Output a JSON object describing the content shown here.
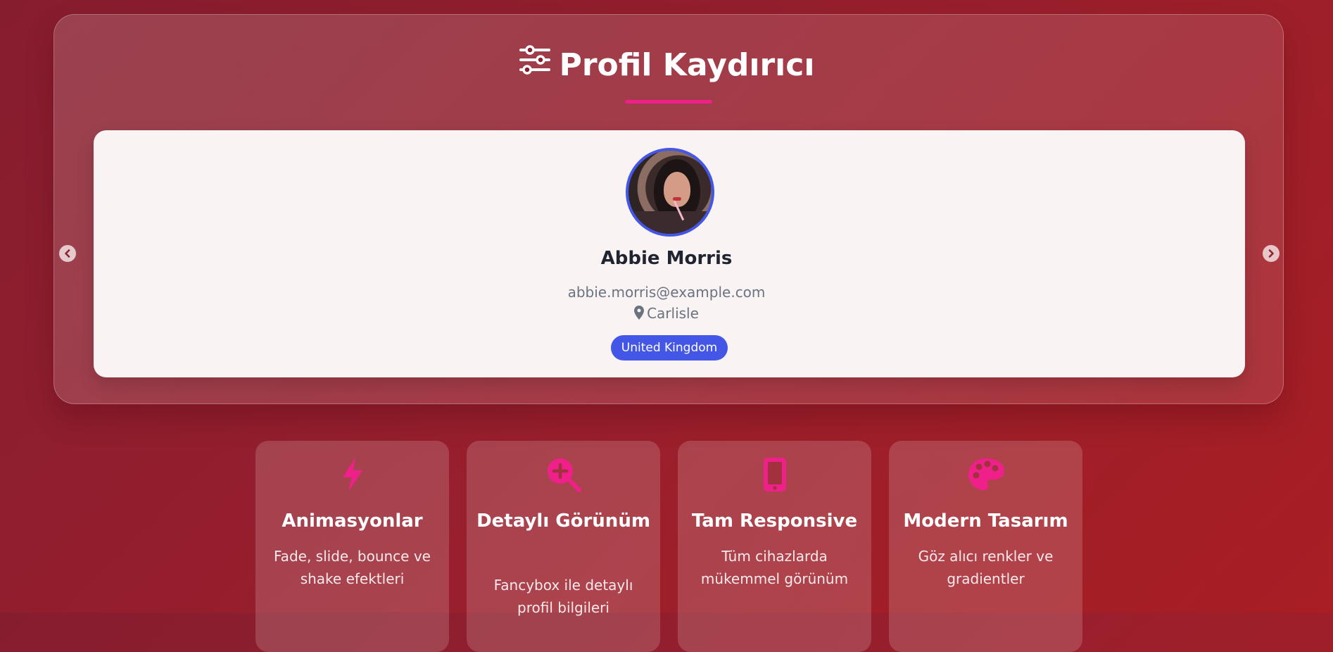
{
  "header": {
    "title": "Profil Kaydırıcı",
    "title_icon": "sliders-icon"
  },
  "profile": {
    "name": "Abbie Morris",
    "email": "abbie.morris@example.com",
    "city": "Carlisle",
    "country": "United Kingdom",
    "avatar_icon": "profile-photo"
  },
  "navigation": {
    "prev_icon": "chevron-left-icon",
    "next_icon": "chevron-right-icon"
  },
  "features": [
    {
      "icon": "bolt-icon",
      "title": "Animasyonlar",
      "description": "Fade, slide, bounce ve shake efektleri"
    },
    {
      "icon": "search-plus-icon",
      "title": "Detaylı Görünüm",
      "description": "Fancybox ile detaylı profil bilgileri"
    },
    {
      "icon": "mobile-icon",
      "title": "Tam Responsive",
      "description": "Tüm cihazlarda mükemmel görünüm"
    },
    {
      "icon": "palette-icon",
      "title": "Modern Tasarım",
      "description": "Göz alıcı renkler ve gradientler"
    }
  ],
  "colors": {
    "accent": "#f0208a",
    "primary": "#4356e6",
    "background": "#9a1f2c"
  }
}
